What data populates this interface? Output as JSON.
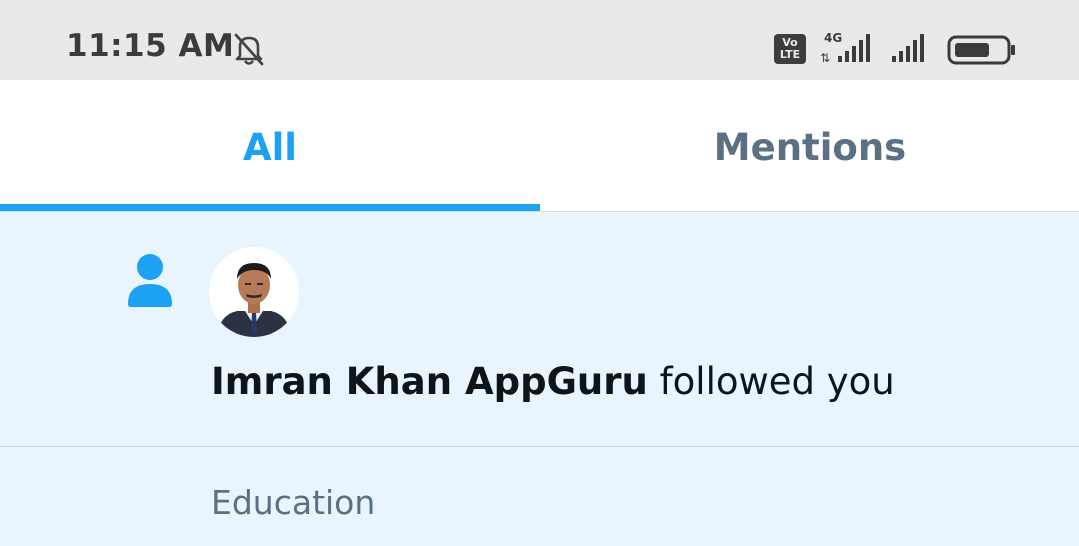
{
  "status_bar": {
    "time": "11:15 AM",
    "volte": "Vo LTE",
    "network": "4G"
  },
  "tabs": [
    {
      "label": "All",
      "active": true
    },
    {
      "label": "Mentions",
      "active": false
    }
  ],
  "notification": {
    "user_name": "Imran Khan AppGuru",
    "action": " followed you",
    "icon": "person-icon"
  },
  "section": {
    "label": "Education"
  },
  "colors": {
    "accent": "#1da1f2",
    "inactive_tab": "#5b7083",
    "highlight_bg": "#e8f5fe"
  }
}
